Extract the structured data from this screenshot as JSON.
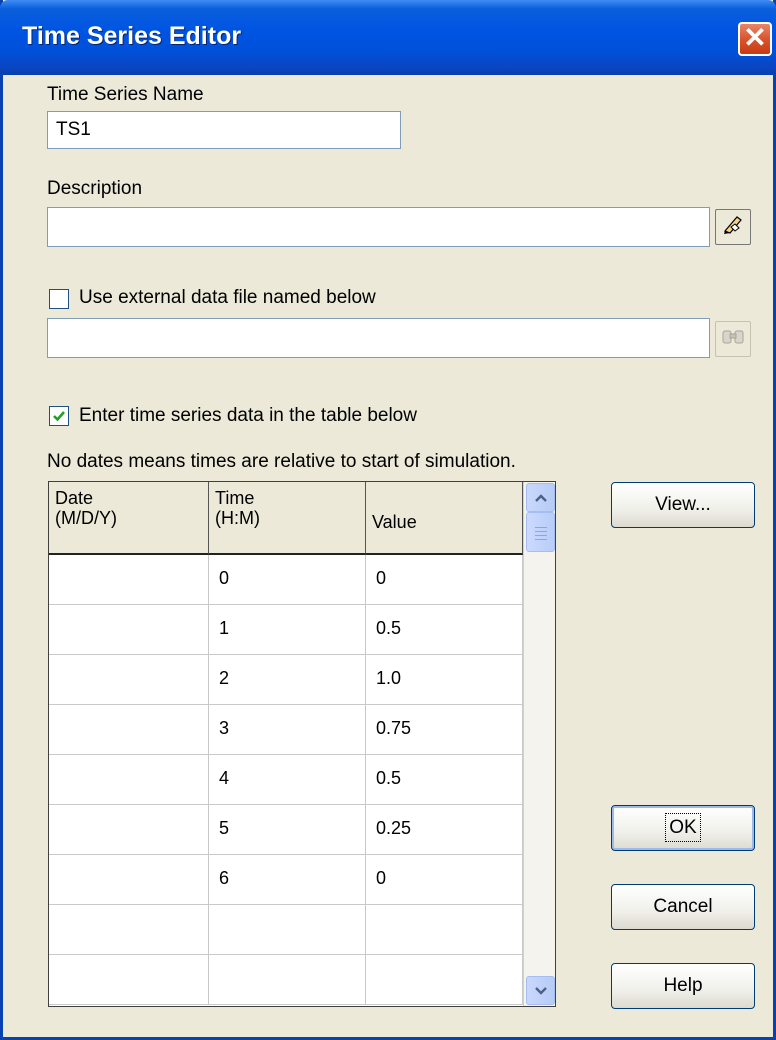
{
  "window": {
    "title": "Time Series Editor",
    "close_label": "✕"
  },
  "form": {
    "name_label": "Time Series Name",
    "name_value": "TS1",
    "description_label": "Description",
    "description_value": "",
    "external_checkbox_label": "Use external data file named below",
    "external_checked": false,
    "external_file_value": "",
    "table_checkbox_label": "Enter time series data in the table below",
    "table_checked": true,
    "note": "No dates means times are relative to start of simulation."
  },
  "table": {
    "headers": {
      "date": "Date\n(M/D/Y)",
      "time": "Time\n(H:M)",
      "value": "Value"
    },
    "rows": [
      {
        "date": "",
        "time": "0",
        "value": "0"
      },
      {
        "date": "",
        "time": "1",
        "value": "0.5"
      },
      {
        "date": "",
        "time": "2",
        "value": "1.0"
      },
      {
        "date": "",
        "time": "3",
        "value": "0.75"
      },
      {
        "date": "",
        "time": "4",
        "value": "0.5"
      },
      {
        "date": "",
        "time": "5",
        "value": "0.25"
      },
      {
        "date": "",
        "time": "6",
        "value": "0"
      },
      {
        "date": "",
        "time": "",
        "value": ""
      },
      {
        "date": "",
        "time": "",
        "value": ""
      }
    ]
  },
  "buttons": {
    "view": "View...",
    "ok": "OK",
    "cancel": "Cancel",
    "help": "Help"
  },
  "icons": {
    "edit_description": "hand-pencil-icon",
    "browse_file": "binoculars-icon",
    "scroll_up": "chevron-up-icon",
    "scroll_down": "chevron-down-icon"
  }
}
